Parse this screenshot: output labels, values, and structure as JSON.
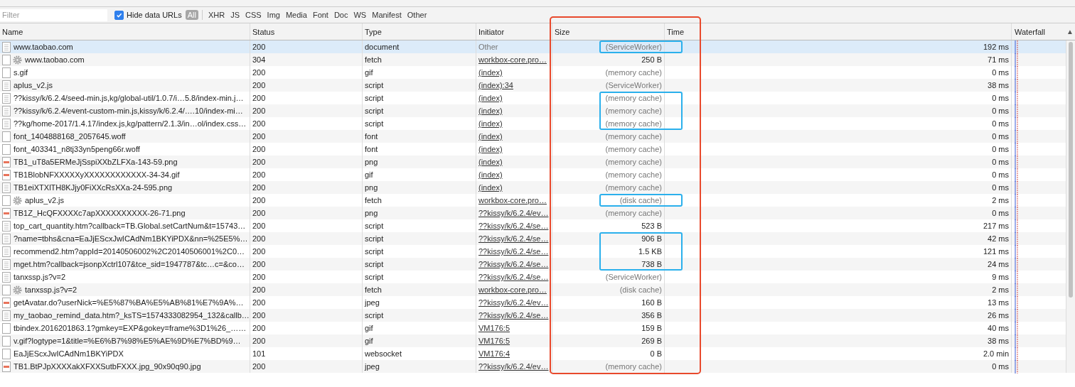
{
  "filter_bar": {
    "placeholder": "Filter",
    "hide_data_urls": {
      "label": "Hide data URLs",
      "checked": true
    },
    "types": [
      {
        "label": "All",
        "selected": true
      },
      {
        "label": "XHR",
        "selected": false
      },
      {
        "label": "JS",
        "selected": false
      },
      {
        "label": "CSS",
        "selected": false
      },
      {
        "label": "Img",
        "selected": false
      },
      {
        "label": "Media",
        "selected": false
      },
      {
        "label": "Font",
        "selected": false
      },
      {
        "label": "Doc",
        "selected": false
      },
      {
        "label": "WS",
        "selected": false
      },
      {
        "label": "Manifest",
        "selected": false
      },
      {
        "label": "Other",
        "selected": false
      }
    ]
  },
  "table": {
    "outlined": true,
    "columns": [
      "Name",
      "Status",
      "Type",
      "Initiator",
      "Size",
      "Time",
      "Waterfall"
    ],
    "sort_indicator": "▲",
    "rows": [
      {
        "kind": "document",
        "name": "www.taobao.com",
        "status": "200",
        "type": "document",
        "initiator": "Other",
        "initiator_link": false,
        "size": "(ServiceWorker)",
        "cached": true,
        "time": "192 ms",
        "selected": true,
        "highlighted": true
      },
      {
        "kind": "gear",
        "name": "www.taobao.com",
        "status": "304",
        "type": "fetch",
        "initiator": "workbox-core.pro…",
        "initiator_link": true,
        "size": "250 B",
        "cached": false,
        "time": "71 ms",
        "selected": false,
        "highlighted": false
      },
      {
        "kind": "blank",
        "name": "s.gif",
        "status": "200",
        "type": "gif",
        "initiator": "(index)",
        "initiator_link": true,
        "size": "(memory cache)",
        "cached": true,
        "time": "0 ms",
        "selected": false,
        "highlighted": false
      },
      {
        "kind": "document",
        "name": "aplus_v2.js",
        "status": "200",
        "type": "script",
        "initiator": "(index):34",
        "initiator_link": true,
        "size": "(ServiceWorker)",
        "cached": true,
        "time": "38 ms",
        "selected": false,
        "highlighted": false
      },
      {
        "kind": "document",
        "name": "??kissy/k/6.2.4/seed-min.js,kg/global-util/1.0.7/i…5.8/index-min.j…",
        "status": "200",
        "type": "script",
        "initiator": "(index)",
        "initiator_link": true,
        "size": "(memory cache)",
        "cached": true,
        "time": "0 ms",
        "selected": false,
        "highlighted": true
      },
      {
        "kind": "document",
        "name": "??kissy/k/6.2.4/event-custom-min.js,kissy/k/6.2.4/….10/index-mi…",
        "status": "200",
        "type": "script",
        "initiator": "(index)",
        "initiator_link": true,
        "size": "(memory cache)",
        "cached": true,
        "time": "0 ms",
        "selected": false,
        "highlighted": true
      },
      {
        "kind": "document",
        "name": "??kg/home-2017/1.4.17/index.js,kg/pattern/2.1.3/in…ol/index.css…",
        "status": "200",
        "type": "script",
        "initiator": "(index)",
        "initiator_link": true,
        "size": "(memory cache)",
        "cached": true,
        "time": "0 ms",
        "selected": false,
        "highlighted": true
      },
      {
        "kind": "blank",
        "name": "font_1404888168_2057645.woff",
        "status": "200",
        "type": "font",
        "initiator": "(index)",
        "initiator_link": true,
        "size": "(memory cache)",
        "cached": true,
        "time": "0 ms",
        "selected": false,
        "highlighted": false
      },
      {
        "kind": "blank",
        "name": "font_403341_n8tj33yn5peng66r.woff",
        "status": "200",
        "type": "font",
        "initiator": "(index)",
        "initiator_link": true,
        "size": "(memory cache)",
        "cached": true,
        "time": "0 ms",
        "selected": false,
        "highlighted": false
      },
      {
        "kind": "image",
        "name": "TB1_uT8a5ERMeJjSspiXXbZLFXa-143-59.png",
        "status": "200",
        "type": "png",
        "initiator": "(index)",
        "initiator_link": true,
        "size": "(memory cache)",
        "cached": true,
        "time": "0 ms",
        "selected": false,
        "highlighted": false
      },
      {
        "kind": "image",
        "name": "TB1BlobNFXXXXXyXXXXXXXXXXXX-34-34.gif",
        "status": "200",
        "type": "gif",
        "initiator": "(index)",
        "initiator_link": true,
        "size": "(memory cache)",
        "cached": true,
        "time": "0 ms",
        "selected": false,
        "highlighted": false
      },
      {
        "kind": "document",
        "name": "TB1eiXTXlTH8KJjy0FiXXcRsXXa-24-595.png",
        "status": "200",
        "type": "png",
        "initiator": "(index)",
        "initiator_link": true,
        "size": "(memory cache)",
        "cached": true,
        "time": "0 ms",
        "selected": false,
        "highlighted": false
      },
      {
        "kind": "gear",
        "name": "aplus_v2.js",
        "status": "200",
        "type": "fetch",
        "initiator": "workbox-core.pro…",
        "initiator_link": true,
        "size": "(disk cache)",
        "cached": true,
        "time": "2 ms",
        "selected": false,
        "highlighted": true
      },
      {
        "kind": "image",
        "name": "TB1Z_HcQFXXXXc7apXXXXXXXXXX-26-71.png",
        "status": "200",
        "type": "png",
        "initiator": "??kissy/k/6.2.4/ev…",
        "initiator_link": true,
        "size": "(memory cache)",
        "cached": true,
        "time": "0 ms",
        "selected": false,
        "highlighted": false
      },
      {
        "kind": "document",
        "name": "top_cart_quantity.htm?callback=TB.Global.setCartNum&t=15743…",
        "status": "200",
        "type": "script",
        "initiator": "??kissy/k/6.2.4/se…",
        "initiator_link": true,
        "size": "523 B",
        "cached": false,
        "time": "217 ms",
        "selected": false,
        "highlighted": false
      },
      {
        "kind": "document",
        "name": "?name=tbhs&cna=EaJjEScxJwICAdNm1BKYiPDX&nn=%25E5%…",
        "status": "200",
        "type": "script",
        "initiator": "??kissy/k/6.2.4/se…",
        "initiator_link": true,
        "size": "906 B",
        "cached": false,
        "time": "42 ms",
        "selected": false,
        "highlighted": true
      },
      {
        "kind": "document",
        "name": "recommend2.htm?appId=20140506002%2C20140506001%2C0…",
        "status": "200",
        "type": "script",
        "initiator": "??kissy/k/6.2.4/se…",
        "initiator_link": true,
        "size": "1.5 KB",
        "cached": false,
        "time": "121 ms",
        "selected": false,
        "highlighted": true
      },
      {
        "kind": "document",
        "name": "mget.htm?callback=jsonpXctrl107&tce_sid=1947787&tc…c=&co…",
        "status": "200",
        "type": "script",
        "initiator": "??kissy/k/6.2.4/se…",
        "initiator_link": true,
        "size": "738 B",
        "cached": false,
        "time": "24 ms",
        "selected": false,
        "highlighted": true
      },
      {
        "kind": "document",
        "name": "tanxssp.js?v=2",
        "status": "200",
        "type": "script",
        "initiator": "??kissy/k/6.2.4/se…",
        "initiator_link": true,
        "size": "(ServiceWorker)",
        "cached": true,
        "time": "9 ms",
        "selected": false,
        "highlighted": false
      },
      {
        "kind": "gear",
        "name": "tanxssp.js?v=2",
        "status": "200",
        "type": "fetch",
        "initiator": "workbox-core.pro…",
        "initiator_link": true,
        "size": "(disk cache)",
        "cached": true,
        "time": "2 ms",
        "selected": false,
        "highlighted": false
      },
      {
        "kind": "image",
        "name": "getAvatar.do?userNick=%E5%87%BA%E5%AB%81%E7%9A%…",
        "status": "200",
        "type": "jpeg",
        "initiator": "??kissy/k/6.2.4/ev…",
        "initiator_link": true,
        "size": "160 B",
        "cached": false,
        "time": "13 ms",
        "selected": false,
        "highlighted": false
      },
      {
        "kind": "document",
        "name": "my_taobao_remind_data.htm?_ksTS=1574333082954_132&callb…",
        "status": "200",
        "type": "script",
        "initiator": "??kissy/k/6.2.4/se…",
        "initiator_link": true,
        "size": "356 B",
        "cached": false,
        "time": "26 ms",
        "selected": false,
        "highlighted": false
      },
      {
        "kind": "blank",
        "name": "tbindex.2016201863.1?gmkey=EXP&gokey=frame%3D1%26_……",
        "status": "200",
        "type": "gif",
        "initiator": "VM176:5",
        "initiator_link": true,
        "size": "159 B",
        "cached": false,
        "time": "40 ms",
        "selected": false,
        "highlighted": false
      },
      {
        "kind": "blank",
        "name": "v.gif?logtype=1&title=%E6%B7%98%E5%AE%9D%E7%BD%9…",
        "status": "200",
        "type": "gif",
        "initiator": "VM176:5",
        "initiator_link": true,
        "size": "269 B",
        "cached": false,
        "time": "38 ms",
        "selected": false,
        "highlighted": false
      },
      {
        "kind": "blank",
        "name": "EaJjEScxJwICAdNm1BKYiPDX",
        "status": "101",
        "type": "websocket",
        "initiator": "VM176:4",
        "initiator_link": true,
        "size": "0 B",
        "cached": false,
        "time": "2.0 min",
        "selected": false,
        "highlighted": false
      },
      {
        "kind": "image",
        "name": "TB1.BtPJpXXXXakXFXXSutbFXXX.jpg_90x90q90.jpg",
        "status": "200",
        "type": "jpeg",
        "initiator": "??kissy/k/6.2.4/ev…",
        "initiator_link": true,
        "size": "(memory cache)",
        "cached": true,
        "time": "0 ms",
        "selected": false,
        "highlighted": false
      }
    ]
  }
}
